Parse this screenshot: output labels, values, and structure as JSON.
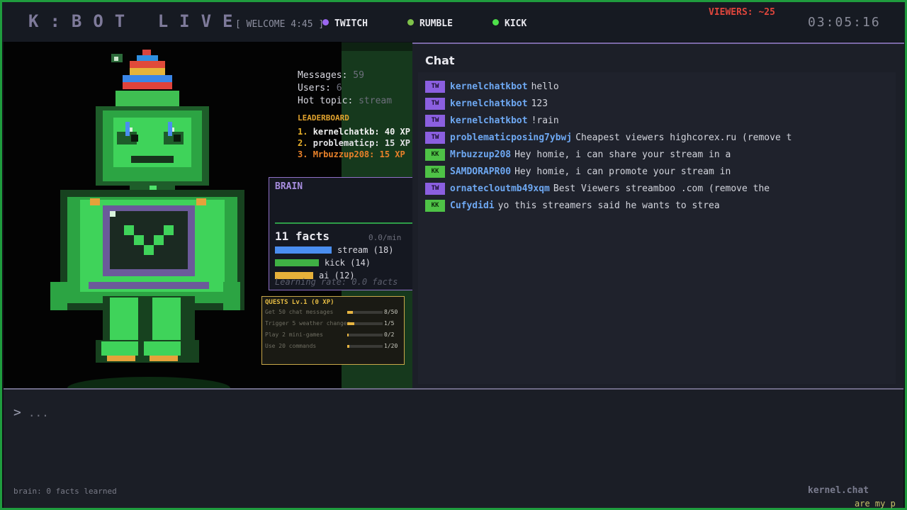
{
  "header": {
    "logo": "K:BOT LIVE",
    "welcome": "[ WELCOME 4:45 ]",
    "platforms": [
      {
        "name": "TWITCH",
        "color": "#9b66f0"
      },
      {
        "name": "RUMBLE",
        "color": "#7ec24a"
      },
      {
        "name": "KICK",
        "color": "#4ee04a"
      }
    ],
    "viewers": "VIEWERS: ~25",
    "clock": "03:05:16"
  },
  "stats": {
    "messages_label": "Messages:",
    "messages_value": "59",
    "users_label": "Users:",
    "users_value": "6",
    "topic_label": "Hot topic:",
    "topic_value": "stream"
  },
  "leaderboard": {
    "title": "LEADERBOARD",
    "entries": [
      {
        "rank": "1.",
        "name": "kernelchatkb:",
        "xp": "40 XP"
      },
      {
        "rank": "2.",
        "name": "problematicp:",
        "xp": "15 XP"
      },
      {
        "rank": "3.",
        "name": "Mrbuzzup208:",
        "xp": "15 XP"
      }
    ]
  },
  "brain": {
    "title": "BRAIN",
    "facts": "11 facts",
    "rate": "0.0/min",
    "topics": [
      {
        "label": "stream (18)",
        "share": 1.0,
        "color": "#4a8ef0"
      },
      {
        "label": "kick (14)",
        "share": 0.78,
        "color": "#3fb044"
      },
      {
        "label": "ai (12)",
        "share": 0.67,
        "color": "#e6b03a"
      }
    ],
    "learning": "Learning rate: 0.0 facts"
  },
  "quests": {
    "title": "QUESTS  Lv.1 (0 XP)",
    "items": [
      {
        "label": "Get 50 chat messages",
        "count": "8/50",
        "progress": 0.16
      },
      {
        "label": "Trigger 5 weather changes",
        "count": "1/5",
        "progress": 0.2
      },
      {
        "label": "Play 2 mini-games",
        "count": "0/2",
        "progress": 0.0
      },
      {
        "label": "Use 20 commands",
        "count": "1/20",
        "progress": 0.05
      }
    ]
  },
  "chat": {
    "title": "Chat",
    "messages": [
      {
        "platform": "TW",
        "user": "kernelchatkbot",
        "text": "hello"
      },
      {
        "platform": "TW",
        "user": "kernelchatkbot",
        "text": "123"
      },
      {
        "platform": "TW",
        "user": "kernelchatkbot",
        "text": "!rain"
      },
      {
        "platform": "TW",
        "user": "problematicposing7ybwj",
        "text": "Cheapest viewers  highcorex.ru (remove t"
      },
      {
        "platform": "KK",
        "user": "Mrbuzzup208",
        "text": "Hey homie, i can share your stream in a"
      },
      {
        "platform": "KK",
        "user": "SAMDORAPR00",
        "text": "Hey homie, i can promote your stream in"
      },
      {
        "platform": "TW",
        "user": "ornatecloutmb49xqm",
        "text": "Best Viewers streamboo .com (remove the"
      },
      {
        "platform": "KK",
        "user": "Cufydidi",
        "text": "yo this streamers said he wants to strea"
      }
    ]
  },
  "input": {
    "prompt": ">",
    "placeholder": "..."
  },
  "footer": {
    "brain_status": "brain: 0 facts learned",
    "site": "kernel.chat",
    "ticker": "are my p"
  }
}
